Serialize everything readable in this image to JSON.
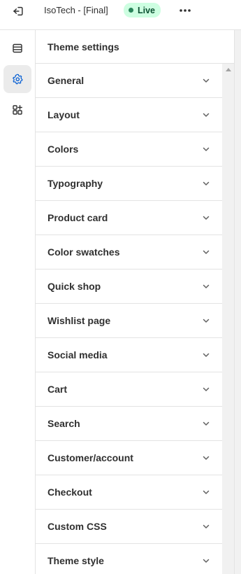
{
  "topbar": {
    "store_name": "IsoTech - [Final]",
    "status_badge": "Live",
    "exit_icon": "exit-icon",
    "more_icon": "more-horizontal-icon"
  },
  "rail": {
    "items": [
      {
        "icon": "sections-icon",
        "active": false
      },
      {
        "icon": "settings-gear-icon",
        "active": true
      },
      {
        "icon": "apps-add-icon",
        "active": false
      }
    ]
  },
  "panel": {
    "title": "Theme settings",
    "items": [
      {
        "label": "General"
      },
      {
        "label": "Layout"
      },
      {
        "label": "Colors"
      },
      {
        "label": "Typography"
      },
      {
        "label": "Product card"
      },
      {
        "label": "Color swatches"
      },
      {
        "label": "Quick shop"
      },
      {
        "label": "Wishlist page"
      },
      {
        "label": "Social media"
      },
      {
        "label": "Cart"
      },
      {
        "label": "Search"
      },
      {
        "label": "Customer/account"
      },
      {
        "label": "Checkout"
      },
      {
        "label": "Custom CSS"
      },
      {
        "label": "Theme style"
      }
    ]
  },
  "colors": {
    "accent_active_icon": "#005bd3",
    "live_badge_bg": "#cdfee1",
    "live_badge_text": "#0c5132",
    "live_dot": "#29845a"
  }
}
